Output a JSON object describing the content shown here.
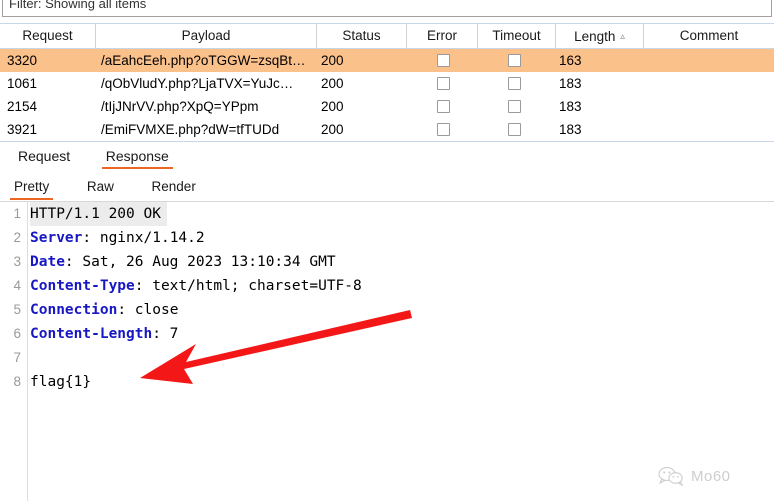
{
  "filter": {
    "text": "Filter: Showing all items"
  },
  "results_table": {
    "columns": [
      {
        "key": "request",
        "label": "Request"
      },
      {
        "key": "payload",
        "label": "Payload"
      },
      {
        "key": "status",
        "label": "Status"
      },
      {
        "key": "error",
        "label": "Error"
      },
      {
        "key": "timeout",
        "label": "Timeout"
      },
      {
        "key": "length",
        "label": "Length",
        "sort": "ascending",
        "sort_icon": "caret-up-icon"
      },
      {
        "key": "comment",
        "label": "Comment"
      }
    ],
    "rows": [
      {
        "request": "3320",
        "payload": "/aEahcEeh.php?oTGGW=zsqBt…",
        "status": "200",
        "error": false,
        "timeout": false,
        "length": "163",
        "comment": "",
        "selected": true
      },
      {
        "request": "1061",
        "payload": "/qObVludY.php?LjaTVX=YuJc…",
        "status": "200",
        "error": false,
        "timeout": false,
        "length": "183",
        "comment": "",
        "selected": false
      },
      {
        "request": "2154",
        "payload": "/tIjJNrVV.php?XpQ=YPpm",
        "status": "200",
        "error": false,
        "timeout": false,
        "length": "183",
        "comment": "",
        "selected": false
      },
      {
        "request": "3921",
        "payload": "/EmiFVMXE.php?dW=tfTUDd",
        "status": "200",
        "error": false,
        "timeout": false,
        "length": "183",
        "comment": "",
        "selected": false
      }
    ]
  },
  "primary_tabs": [
    {
      "label": "Request",
      "active": false
    },
    {
      "label": "Response",
      "active": true
    }
  ],
  "secondary_tabs": [
    {
      "label": "Pretty",
      "active": true
    },
    {
      "label": "Raw",
      "active": false
    },
    {
      "label": "Render",
      "active": false
    }
  ],
  "response": {
    "lines": [
      {
        "num": "1",
        "key": "",
        "value": "HTTP/1.1 200 OK",
        "highlight": true
      },
      {
        "num": "2",
        "key": "Server",
        "value": ": nginx/1.14.2",
        "highlight": false
      },
      {
        "num": "3",
        "key": "Date",
        "value": ": Sat, 26 Aug 2023 13:10:34 GMT",
        "highlight": false
      },
      {
        "num": "4",
        "key": "Content-Type",
        "value": ": text/html; charset=UTF-8",
        "highlight": false
      },
      {
        "num": "5",
        "key": "Connection",
        "value": ": close",
        "highlight": false
      },
      {
        "num": "6",
        "key": "Content-Length",
        "value": ": 7",
        "highlight": false
      },
      {
        "num": "7",
        "key": "",
        "value": "",
        "highlight": false
      },
      {
        "num": "8",
        "key": "",
        "value": "flag{1}",
        "highlight": false
      }
    ]
  },
  "annotation": {
    "type": "arrow",
    "color": "#f41717",
    "points_to": "flag{1}"
  },
  "watermark": {
    "icon": "wechat-icon",
    "text": "Mo60"
  },
  "colors": {
    "selection": "#fbc18b",
    "accent": "#ec6724",
    "header_key": "#1717c4",
    "annotation": "#f41717"
  }
}
